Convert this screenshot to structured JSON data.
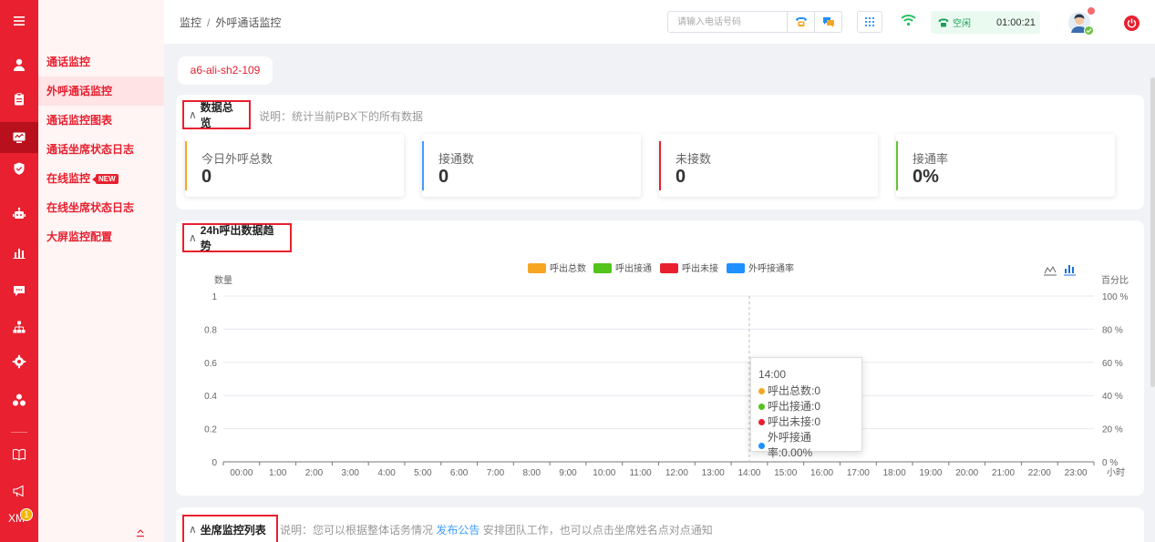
{
  "rail": {
    "icons": [
      "menu-icon",
      "user-icon",
      "clipboard-icon",
      "monitor-icon",
      "shield-icon",
      "robot-icon",
      "bar-chart-icon",
      "chat-icon",
      "org-chart-icon",
      "gear-icon",
      "cluster-icon",
      "book-icon",
      "megaphone-icon"
    ],
    "xm_label": "XM",
    "xm_badge": "1",
    "active_index": 3
  },
  "submenu": {
    "items": [
      {
        "label": "通话监控"
      },
      {
        "label": "外呼通话监控"
      },
      {
        "label": "通话监控图表"
      },
      {
        "label": "通话坐席状态日志"
      },
      {
        "label": "在线监控",
        "badge": "NEW"
      },
      {
        "label": "在线坐席状态日志"
      },
      {
        "label": "大屏监控配置"
      }
    ],
    "active_index": 1
  },
  "topbar": {
    "breadcrumb": [
      "监控",
      "外呼通话监控"
    ],
    "breadcrumb_sep": "/",
    "phone_placeholder": "请输入电话号码",
    "status": "空闲",
    "timer": "01:00:21"
  },
  "pbx_tag": "a6-ali-sh2-109",
  "overview": {
    "title": "数据总览",
    "desc": "说明：统计当前PBX下的所有数据",
    "stats": [
      {
        "label": "今日外呼总数",
        "value": "0",
        "color": "#f5a623"
      },
      {
        "label": "接通数",
        "value": "0",
        "color": "#409eff"
      },
      {
        "label": "未接数",
        "value": "0",
        "color": "#e8202f"
      },
      {
        "label": "接通率",
        "value": "0%",
        "color": "#67c23a"
      }
    ]
  },
  "trend": {
    "title": "24h呼出数据趋势"
  },
  "chart_data": {
    "type": "bar",
    "categories": [
      "00:00",
      "1:00",
      "2:00",
      "3:00",
      "4:00",
      "5:00",
      "6:00",
      "7:00",
      "8:00",
      "9:00",
      "10:00",
      "11:00",
      "12:00",
      "13:00",
      "14:00",
      "15:00",
      "16:00",
      "17:00",
      "18:00",
      "19:00",
      "20:00",
      "21:00",
      "22:00",
      "23:00"
    ],
    "series": [
      {
        "name": "呼出总数",
        "color": "#f5a623",
        "values": [
          0,
          0,
          0,
          0,
          0,
          0,
          0,
          0,
          0,
          0,
          0,
          0,
          0,
          0,
          0,
          0,
          0,
          0,
          0,
          0,
          0,
          0,
          0,
          0
        ]
      },
      {
        "name": "呼出接通",
        "color": "#52c41a",
        "values": [
          0,
          0,
          0,
          0,
          0,
          0,
          0,
          0,
          0,
          0,
          0,
          0,
          0,
          0,
          0,
          0,
          0,
          0,
          0,
          0,
          0,
          0,
          0,
          0
        ]
      },
      {
        "name": "呼出未接",
        "color": "#e8202f",
        "values": [
          0,
          0,
          0,
          0,
          0,
          0,
          0,
          0,
          0,
          0,
          0,
          0,
          0,
          0,
          0,
          0,
          0,
          0,
          0,
          0,
          0,
          0,
          0,
          0
        ]
      },
      {
        "name": "外呼接通率",
        "color": "#1e90ff",
        "values": [
          0,
          0,
          0,
          0,
          0,
          0,
          0,
          0,
          0,
          0,
          0,
          0,
          0,
          0,
          0,
          0,
          0,
          0,
          0,
          0,
          0,
          0,
          0,
          0
        ]
      }
    ],
    "ylabel": "数量",
    "y2label": "百分比",
    "xunit": "小时",
    "ylim": [
      0,
      1
    ],
    "yticks": [
      "0",
      "0.2",
      "0.4",
      "0.6",
      "0.8",
      "1"
    ],
    "y2ticks": [
      "0 %",
      "20 %",
      "40 %",
      "60 %",
      "80 %",
      "100 %"
    ],
    "legend_position": "top-center",
    "grid": true,
    "tooltip": {
      "title": "14:00",
      "rows": [
        "呼出总数:0",
        "呼出接通:0",
        "呼出未接:0",
        "外呼接通率:0.00%"
      ]
    }
  },
  "agents": {
    "title": "坐席监控列表",
    "desc_before": "说明：您可以根据整体话务情况",
    "desc_link": "发布公告",
    "desc_after": "安排团队工作，也可以点击坐席姓名点对点通知"
  }
}
